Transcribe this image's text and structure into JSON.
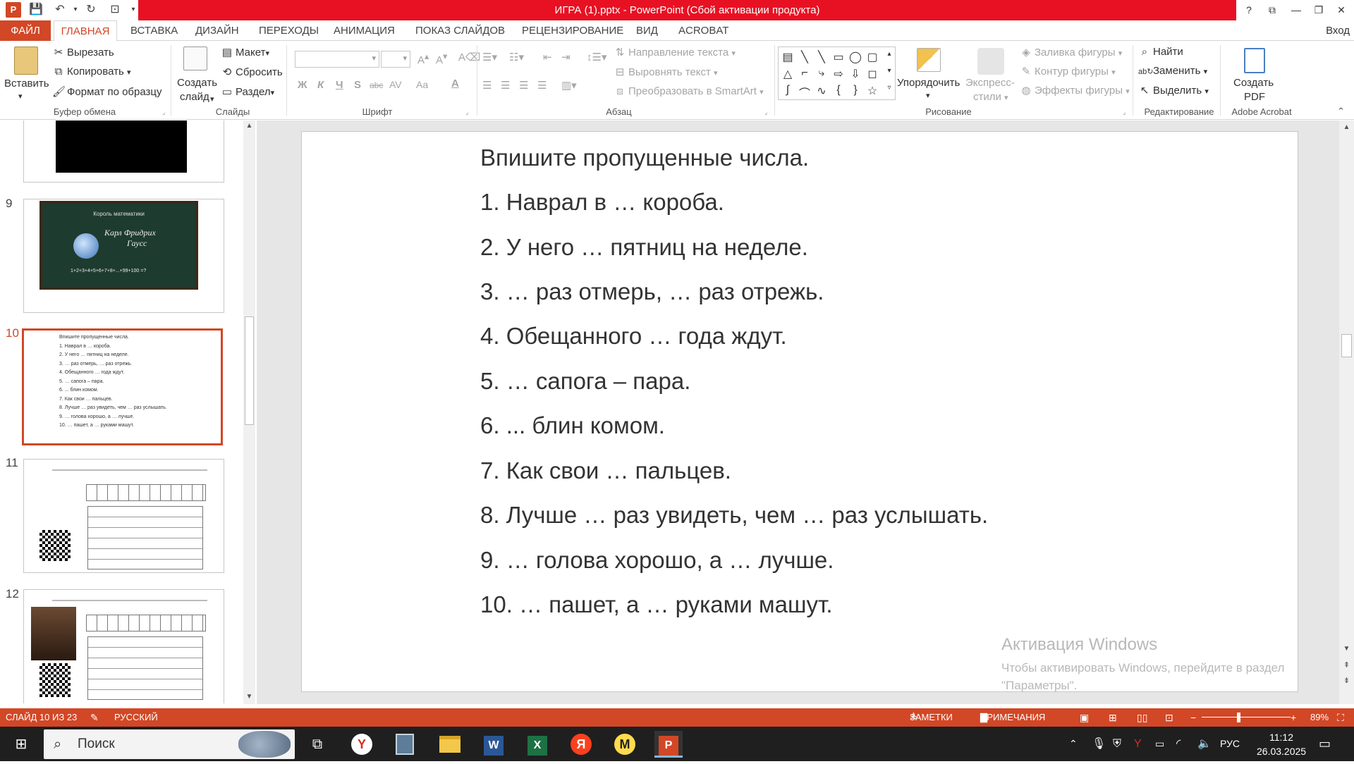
{
  "window": {
    "title": "ИГРА (1).pptx - PowerPoint (Сбой активации продукта)",
    "help": "?",
    "app_icon": "P"
  },
  "tabs": {
    "file": "ФАЙЛ",
    "items": [
      "ГЛАВНАЯ",
      "ВСТАВКА",
      "ДИЗАЙН",
      "ПЕРЕХОДЫ",
      "АНИМАЦИЯ",
      "ПОКАЗ СЛАЙДОВ",
      "РЕЦЕНЗИРОВАНИЕ",
      "ВИД",
      "ACROBAT"
    ],
    "signin": "Вход"
  },
  "ribbon": {
    "clipboard": {
      "paste": "Вставить",
      "cut": "Вырезать",
      "copy": "Копировать",
      "format": "Формат по образцу",
      "label": "Буфер обмена"
    },
    "slides": {
      "new_slide_line1": "Создать",
      "new_slide_line2": "слайд",
      "layout": "Макет",
      "reset": "Сбросить",
      "section": "Раздел",
      "label": "Слайды"
    },
    "font": {
      "label": "Шрифт",
      "bold": "Ж",
      "italic": "К",
      "underline": "Ч",
      "shadow": "S",
      "strike": "abc",
      "spacing": "AV",
      "case": "Aa",
      "color": "A"
    },
    "paragraph": {
      "text_direction": "Направление текста",
      "align_text": "Выровнять текст",
      "smartart": "Преобразовать в SmartArt",
      "label": "Абзац"
    },
    "drawing": {
      "arrange": "Упорядочить",
      "quick_styles_line1": "Экспресс-",
      "quick_styles_line2": "стили",
      "fill": "Заливка фигуры",
      "outline": "Контур фигуры",
      "effects": "Эффекты фигуры",
      "label": "Рисование"
    },
    "editing": {
      "find": "Найти",
      "replace": "Заменить",
      "select": "Выделить",
      "label": "Редактирование"
    },
    "acrobat": {
      "create_line1": "Создать",
      "create_line2": "PDF",
      "label": "Adobe Acrobat"
    }
  },
  "thumbnails": {
    "t9": {
      "num": "9",
      "heading": "Король математики",
      "name_line1": "Карл Фридрих",
      "name_line2": "Гаусс",
      "formula": "1+2+3+4+5+6+7+8+...+99+100 =?"
    },
    "t10": {
      "num": "10"
    },
    "t11": {
      "num": "11"
    },
    "t12": {
      "num": "12"
    }
  },
  "slide": {
    "title": "Впишите пропущенные числа.",
    "lines": [
      "1. Наврал в … короба.",
      "2. У него … пятниц на неделе.",
      "3. … раз отмерь, … раз отрежь.",
      "4. Обещанного … года ждут.",
      "5. … сапога – пара.",
      "6. ... блин комом.",
      "7. Как свои … пальцев.",
      "8. Лучше … раз увидеть, чем … раз услышать.",
      "9. … голова хорошо, а … лучше.",
      "10. … пашет, а … руками машут."
    ]
  },
  "watermark": {
    "title": "Активация Windows",
    "line1": "Чтобы активировать Windows, перейдите в раздел",
    "line2": "\"Параметры\"."
  },
  "status": {
    "slide_counter": "СЛАЙД 10 ИЗ 23",
    "language": "РУССКИЙ",
    "notes": "ЗАМЕТКИ",
    "comments": "ПРИМЕЧАНИЯ",
    "zoom": "89%"
  },
  "taskbar": {
    "search": "Поиск",
    "lang": "РУС",
    "time": "11:12",
    "date": "26.03.2025"
  },
  "colors": {
    "accent": "#d24726",
    "title_red": "#e81123"
  }
}
